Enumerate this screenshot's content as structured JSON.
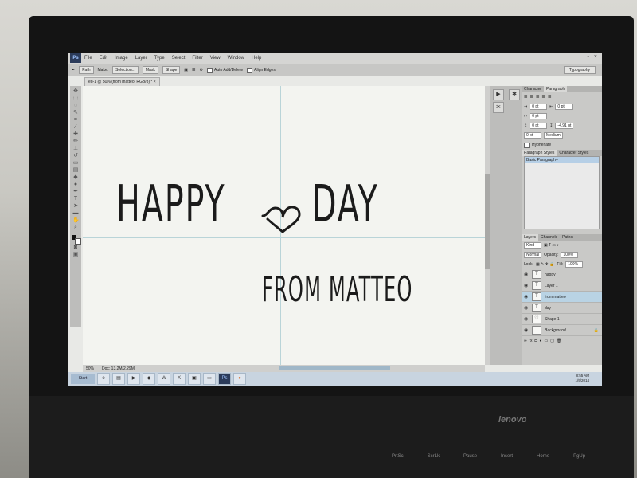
{
  "menu": {
    "logo": "Ps",
    "items": [
      "File",
      "Edit",
      "Image",
      "Layer",
      "Type",
      "Select",
      "Filter",
      "View",
      "Window",
      "Help"
    ],
    "window_controls": [
      "–",
      "▫",
      "×"
    ]
  },
  "options_bar": {
    "path_label": "Path",
    "make_label": "Make:",
    "selection_btn": "Selection...",
    "mask_btn": "Mask",
    "shape_btn": "Shape",
    "auto_add_delete": "Auto Add/Delete",
    "align_edges": "Align Edges",
    "workspace": "Typography"
  },
  "document": {
    "tab_title": "ed-1 @ 50% (from matteo, RGB/8) *",
    "headline_left": "HAPPY",
    "headline_right": "DAY",
    "subline": "FROM MATTEO",
    "zoom": "50%",
    "doc_info": "Doc: 13.2M/2.29M"
  },
  "panels": {
    "top_tabs": [
      "Character",
      "Paragraph"
    ],
    "indent_values": [
      "0 pt",
      "0 pt",
      "0 pt",
      "0 pt",
      "0 pt"
    ],
    "space_after": "-4.91 pt",
    "hyphenate_label": "Hyphenate",
    "composer": "Medium",
    "style_tabs": [
      "Paragraph Styles",
      "Character Styles"
    ],
    "selected_style": "Basic Paragraph+",
    "layer_tabs": [
      "Layers",
      "Channels",
      "Paths"
    ],
    "kind": "Kind",
    "blend_mode": "Normal",
    "opacity_label": "Opacity:",
    "opacity": "100%",
    "lock_label": "Lock:",
    "fill_label": "Fill:",
    "fill": "100%",
    "layers": [
      {
        "name": "happy",
        "type": "T"
      },
      {
        "name": "Layer 1",
        "type": "T"
      },
      {
        "name": "from matteo",
        "type": "T"
      },
      {
        "name": "day",
        "type": "T"
      },
      {
        "name": "Shape 1",
        "type": "shape"
      },
      {
        "name": "Background",
        "type": "bg"
      }
    ]
  },
  "taskbar": {
    "start": "Start",
    "time": "8:55 AM",
    "date": "1/9/2014"
  },
  "laptop": {
    "brand": "lenovo"
  },
  "keyboard_labels": [
    "PrtSc",
    "ScrLk",
    "Pause",
    "Insert",
    "Home",
    "PgUp"
  ],
  "colors": {
    "accent": "#b9d3e4",
    "text": "#1b1b1b"
  }
}
